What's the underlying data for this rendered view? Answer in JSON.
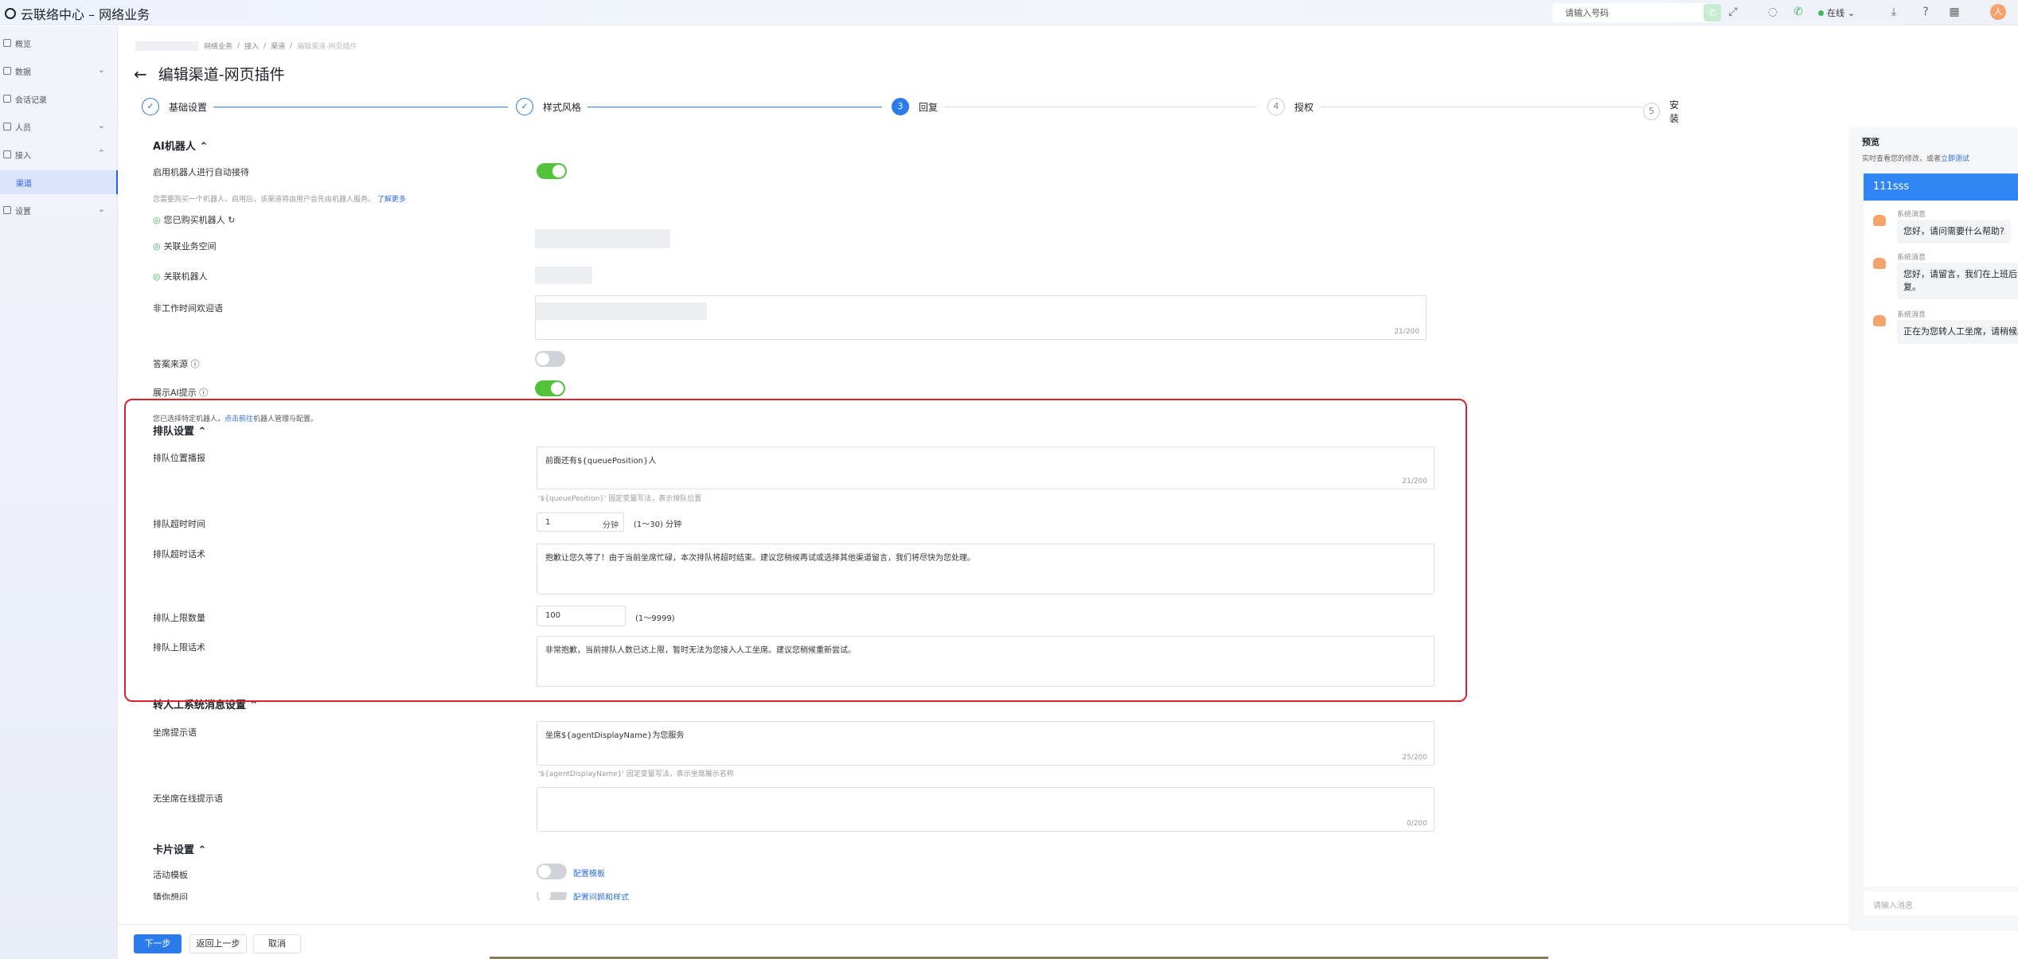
{
  "app": {
    "title": "云联络中心 – 网络业务"
  },
  "topbar": {
    "dial_placeholder": "请输入号码",
    "status": "在线",
    "avatar": "人"
  },
  "sidebar": {
    "items": [
      {
        "label": "概览"
      },
      {
        "label": "数据"
      },
      {
        "label": "会话记录"
      },
      {
        "label": "人员"
      },
      {
        "label": "接入"
      },
      {
        "label": "渠道"
      },
      {
        "label": "设置"
      }
    ]
  },
  "breadcrumb": [
    "网络业务",
    "/",
    "接入",
    "/",
    "渠道",
    "/",
    "编辑渠道-网页插件"
  ],
  "page": {
    "title": "编辑渠道-网页插件"
  },
  "steps": [
    {
      "num": "✓",
      "label": "基础设置"
    },
    {
      "num": "✓",
      "label": "样式风格"
    },
    {
      "num": "3",
      "label": "回复"
    },
    {
      "num": "4",
      "label": "授权"
    },
    {
      "num": "5",
      "label": "安装"
    }
  ],
  "ai": {
    "section": "AI机器人",
    "auto_label": "启用机器人进行自动接待",
    "hint": "您需要购买一个机器人，启用后，该渠道将由用户会先由机器人服务。",
    "learn_more": "了解更多",
    "bought": "您已购买机器人",
    "workspace": "关联业务空间",
    "robot": "关联机器人",
    "welcome_label": "非工作时间欢迎语",
    "welcome_count": "21/200",
    "answer_source": "答案来源",
    "show_ai": "展示AI提示",
    "robot_note_a": "您已选择特定机器人，",
    "robot_note_link": "点击前往",
    "robot_note_b": "机器人管理与配置。"
  },
  "queue": {
    "section": "排队设置",
    "pos_label": "排队位置播报",
    "pos_value": "前面还有${queuePosition}人",
    "pos_count": "21/200",
    "pos_hint": "'${queuePosition}' 固定变量写法，表示排队位置",
    "timeout_label": "排队超时时间",
    "timeout_value": "1",
    "timeout_unit": "分钟",
    "timeout_range": "(1～30) 分钟",
    "timeout_msg_label": "排队超时话术",
    "timeout_msg": "抱歉让您久等了！由于当前坐席忙碌，本次排队将超时结束。建议您稍候再试或选择其他渠道留言，我们将尽快为您处理。",
    "limit_label": "排队上限数量",
    "limit_value": "100",
    "limit_range": "(1～9999)",
    "limit_msg_label": "排队上限话术",
    "limit_msg": "非常抱歉，当前排队人数已达上限，暂时无法为您接入人工坐席。建议您稍候重新尝试。"
  },
  "transfer": {
    "section": "转人工系统消息设置",
    "agent_label": "坐席提示语",
    "agent_value": "坐席${agentDisplayName}为您服务",
    "agent_count": "25/200",
    "agent_hint": "'${agentDisplayName}' 固定变量写法，表示坐席展示名称",
    "none_label": "无坐席在线提示语",
    "none_count": "0/200"
  },
  "card": {
    "section": "卡片设置",
    "activity_label": "活动模板",
    "config_template": "配置模板",
    "next_label": "猜你想问",
    "config_next": "配置问题和样式"
  },
  "footer": {
    "next": "下一步",
    "back": "返回上一步",
    "cancel": "取消"
  },
  "preview": {
    "title": "预览",
    "sub_a": "实时查看您的修改，或者",
    "sub_link": "立即测试",
    "header": "111sss",
    "sender": "系统消息",
    "messages": [
      "您好，请问需要什么帮助?",
      "您好，请留言，我们在上班后会第一时间回复。",
      "正在为您转人工坐席，请稍候。"
    ],
    "input_placeholder": "请输入消息"
  },
  "colors": {
    "primary": "#2b7bea",
    "toggle_on": "#52c23a",
    "highlight": "#d6252a"
  }
}
